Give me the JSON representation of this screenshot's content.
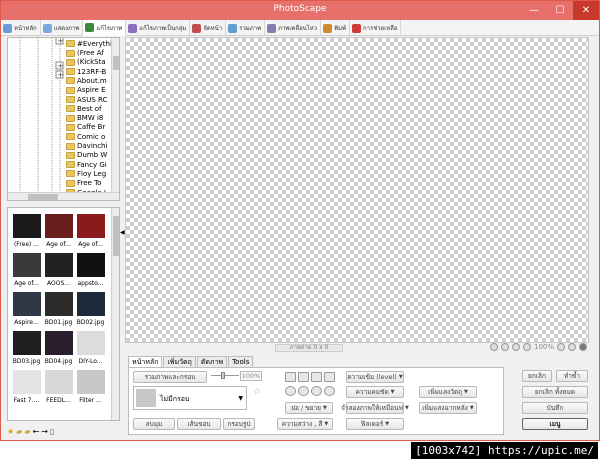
{
  "window": {
    "title": "PhotoScape",
    "minimize": "—",
    "maximize": "☐",
    "close": "✕"
  },
  "tabs": [
    {
      "label": "หน้าหลัก",
      "color": "#6a9bd8"
    },
    {
      "label": "แสดงภาพ",
      "color": "#7aa7e0"
    },
    {
      "label": "แก้ไขภาพ",
      "color": "#3c8a3c"
    },
    {
      "label": "แก้ไขภาพเป็นกลุ่ม",
      "color": "#8a6fc0"
    },
    {
      "label": "จัดหน้า",
      "color": "#c05050"
    },
    {
      "label": "รวมภาพ",
      "color": "#5fa0d0"
    },
    {
      "label": "ภาพเคลื่อนไหว",
      "color": "#8080b0"
    },
    {
      "label": "พิมพ์",
      "color": "#d08a2e"
    },
    {
      "label": "การช่วยเหลือ",
      "color": "#d03a3a"
    }
  ],
  "tree": {
    "items": [
      "#Everything",
      "(Free Af",
      "(KickSta",
      "123RF-B",
      "About.m",
      "Aspire E",
      "ASUS RC",
      "Best of",
      "BMW i8",
      "Caffe Br",
      "Comic o",
      "Davinchi",
      "Dumb W",
      "Fancy Gi",
      "Floy Leg",
      "Free To",
      "Google L"
    ]
  },
  "thumbs": [
    {
      "caption": "(Free) ...",
      "color": "#1a1a1a"
    },
    {
      "caption": "Age of...",
      "color": "#6b1e1e"
    },
    {
      "caption": "Age of...",
      "color": "#8a1a1a"
    },
    {
      "caption": "Age of...",
      "color": "#3a3a3a"
    },
    {
      "caption": "AOOS...",
      "color": "#222222"
    },
    {
      "caption": "appsto...",
      "color": "#111111"
    },
    {
      "caption": "Aspire...",
      "color": "#303848"
    },
    {
      "caption": "BD01.jpg",
      "color": "#2b2b2b"
    },
    {
      "caption": "BD02.jpg",
      "color": "#1c2a3a"
    },
    {
      "caption": "BD03.jpg",
      "color": "#1f1f1f"
    },
    {
      "caption": "BD04.jpg",
      "color": "#2a1e2e"
    },
    {
      "caption": "DIY-Lo...",
      "color": "#dcdcdc"
    },
    {
      "caption": "Fast 7....",
      "color": "#e4e4e4"
    },
    {
      "caption": "FEEDL...",
      "color": "#d8d8d8"
    },
    {
      "caption": "Filter ...",
      "color": "#c8c8c8"
    }
  ],
  "status": {
    "image_info": "ภาพถ่าย 0 x 0",
    "zoom": "100%"
  },
  "edit_tabs": [
    "หน้าหลัก",
    "เพิ่มวัตถุ",
    "ตัดภาพ",
    "Tools"
  ],
  "edit": {
    "frame_merge": "รวมภาพและกรอบ",
    "frame_pct": "100%",
    "frame_none": "ไม่มีกรอบ",
    "round": "ลบมุม",
    "margin": "เส้นขอบ",
    "frame_line": "กรอบรูป",
    "level": "ความเข้ม (level)",
    "sharpness": "ความคมชัด",
    "resize": "ย่อ / ขยาย",
    "vignette": "จำลองภาพให้เหมือนฟ",
    "bright_color": "ความสว่าง , สี",
    "filter": "ฟิลเตอร์",
    "backlight": "เพิ่มแสงวัตถุ",
    "backlight2": "เพิ่มแสงฉากหลัง"
  },
  "right": {
    "undo": "ยกเลิก",
    "redo": "ทำซ้ำ",
    "undo_all": "ยกเลิก ทั้งหมด",
    "save": "บันทึก",
    "menu": "เมนู"
  },
  "watermark": "[1003x742] https://upic.me/"
}
